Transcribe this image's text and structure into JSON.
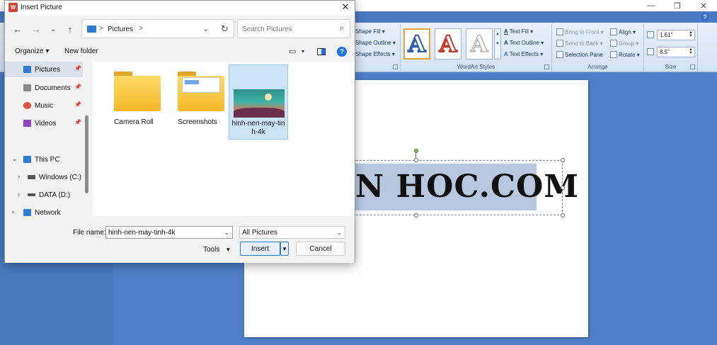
{
  "dialog": {
    "title": "Insert Picture",
    "close_glyph": "✕",
    "address": {
      "separator": ">",
      "crumb": "Pictures",
      "trailing_sep": ">"
    },
    "search_placeholder": "Search Pictures",
    "toolbar": {
      "organize": "Organize ▾",
      "new_folder": "New folder"
    },
    "nav_items": [
      {
        "label": "Pictures",
        "pinned": true,
        "icon": "pictures-icon"
      },
      {
        "label": "Documents",
        "pinned": true,
        "icon": "documents-icon"
      },
      {
        "label": "Music",
        "pinned": true,
        "icon": "music-icon"
      },
      {
        "label": "Videos",
        "pinned": true,
        "icon": "videos-icon"
      },
      {
        "label": "This PC",
        "icon": "this-pc-icon"
      },
      {
        "label": "Windows (C:)",
        "icon": "drive-icon"
      },
      {
        "label": "DATA (D:)",
        "icon": "drive-icon"
      },
      {
        "label": "Network",
        "icon": "network-icon"
      }
    ],
    "files": [
      {
        "label": "Camera Roll",
        "type": "folder"
      },
      {
        "label": "Screenshots",
        "type": "folder"
      },
      {
        "label": "hinh-nen-may-tin h-4k",
        "type": "image",
        "selected": true
      }
    ],
    "file_name_label": "File name:",
    "file_name_value": "hinh-nen-may-tinh-4k",
    "filter_value": "All Pictures",
    "tools_label": "Tools",
    "insert_label": "Insert",
    "cancel_label": "Cancel"
  },
  "ribbon": {
    "shape_styles": [
      "Shape Fill ▾",
      "Shape Outline ▾",
      "Shape Effects ▾"
    ],
    "wordart_group_label": "WordArt Styles",
    "wordart_sample": "A",
    "text_items": [
      "Text Fill ▾",
      "Text Outline ▾",
      "Text Effects ▾"
    ],
    "arrange_items": [
      "Bring to Front ▾",
      "Send to Back ▾",
      "Selection Pane"
    ],
    "arrange_items2": [
      "Align ▾",
      "Group ▾",
      "Rotate ▾"
    ],
    "arrange_label": "Arrange",
    "size_height": "1.61\"",
    "size_width": "8.5\"",
    "size_label": "Size"
  },
  "document": {
    "wordart_text": "N HOC.COM"
  },
  "colors": {
    "accent": "#1a73e8",
    "doc_bg": "#4f7fc8",
    "folder": "#f5b829"
  }
}
